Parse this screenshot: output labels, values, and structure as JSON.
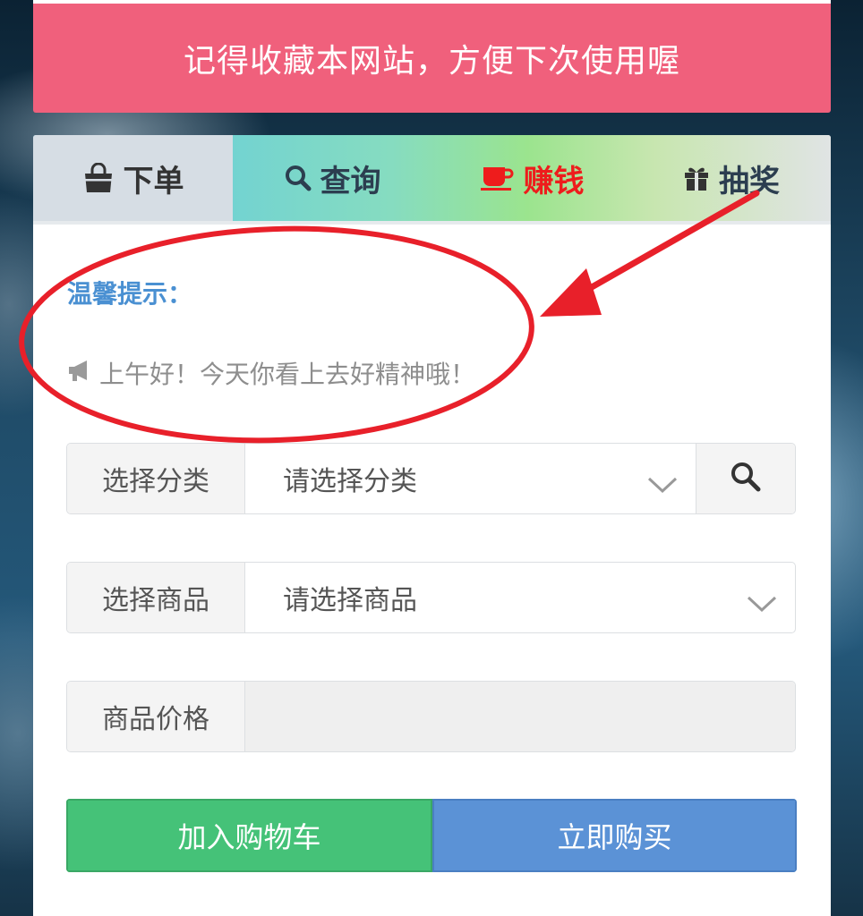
{
  "banner": {
    "text": "记得收藏本网站，方便下次使用喔"
  },
  "tabs": [
    {
      "label": "下单",
      "icon": "shopping-bag-icon"
    },
    {
      "label": "查询",
      "icon": "search-icon"
    },
    {
      "label": "赚钱",
      "icon": "coffee-cup-icon"
    },
    {
      "label": "抽奖",
      "icon": "gift-icon"
    }
  ],
  "tip": {
    "title": "温馨提示：",
    "message": "上午好！今天你看上去好精神哦！",
    "icon": "bullhorn-icon"
  },
  "form": {
    "category": {
      "label": "选择分类",
      "value": "请选择分类"
    },
    "product": {
      "label": "选择商品",
      "value": "请选择商品"
    },
    "price": {
      "label": "商品价格",
      "value": ""
    }
  },
  "actions": {
    "add_to_cart": "加入购物车",
    "buy_now": "立即购买"
  },
  "colors": {
    "banner": "#f0607c",
    "earn_tab": "#ee1c1c",
    "tip_title": "#4a90d2",
    "cart_button": "#45c278",
    "buy_button": "#5b92d6",
    "annotation": "#e8202a"
  }
}
